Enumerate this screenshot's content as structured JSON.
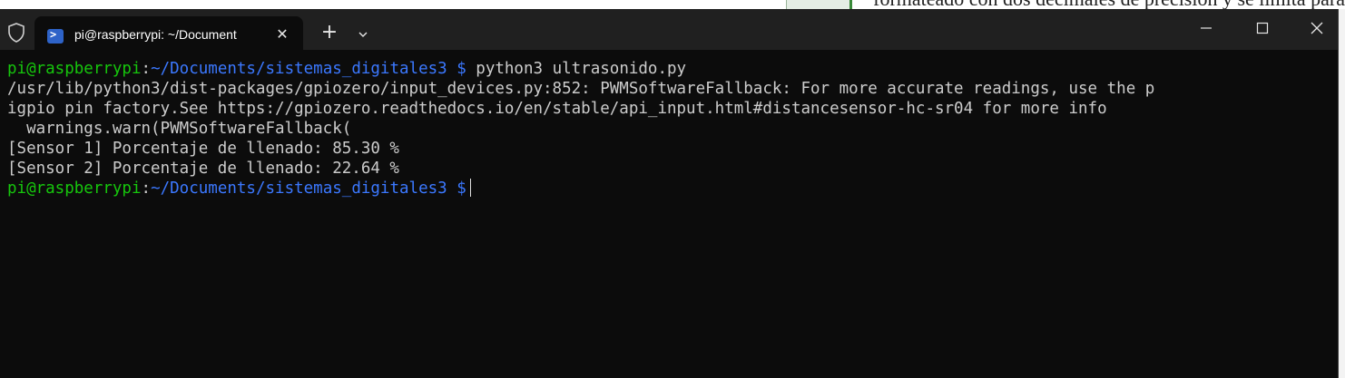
{
  "background": {
    "partial_text": "formateado con dos decimales de precisión y se limita para"
  },
  "window": {
    "tab": {
      "title": "pi@raspberrypi: ~/Document",
      "icon": "powershell-icon",
      "close_icon": "close-icon"
    },
    "toolbar": {
      "new_tab_icon": "plus-icon",
      "dropdown_icon": "chevron-down-icon",
      "shield_icon": "shield-icon"
    },
    "controls": {
      "minimize_icon": "minimize-icon",
      "maximize_icon": "maximize-icon",
      "close_icon": "close-icon"
    }
  },
  "terminal": {
    "colors": {
      "background": "#0c0c0c",
      "text": "#cccccc",
      "user": "#16c60c",
      "path": "#3b78ff"
    },
    "prompt": {
      "user": "pi@raspberrypi",
      "sep": ":",
      "path": "~/Documents/sistemas_digitales3 $"
    },
    "command": " python3 ultrasonido.py",
    "output": [
      "/usr/lib/python3/dist-packages/gpiozero/input_devices.py:852: PWMSoftwareFallback: For more accurate readings, use the p",
      "igpio pin factory.See https://gpiozero.readthedocs.io/en/stable/api_input.html#distancesensor-hc-sr04 for more info",
      "  warnings.warn(PWMSoftwareFallback(",
      "[Sensor 1] Porcentaje de llenado: 85.30 %",
      "[Sensor 2] Porcentaje de llenado: 22.64 %"
    ]
  }
}
